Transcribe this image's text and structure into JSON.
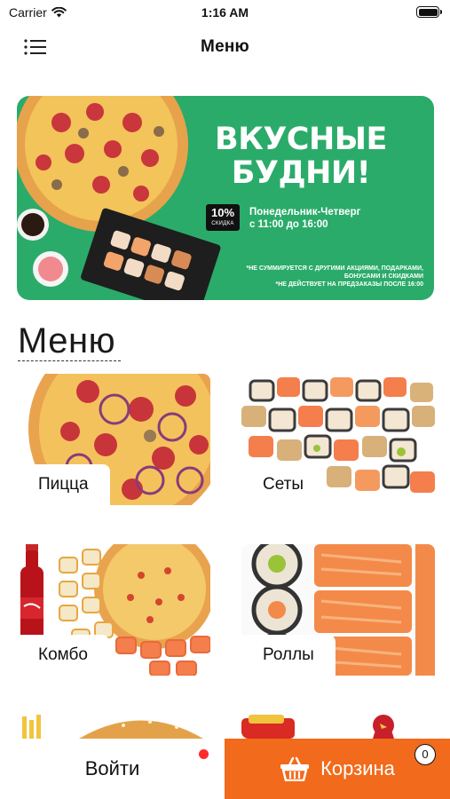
{
  "status_bar": {
    "carrier": "Carrier",
    "time": "1:16 AM"
  },
  "nav": {
    "title": "Меню"
  },
  "banner": {
    "heading_line1": "ВКУСНЫЕ",
    "heading_line2": "БУДНИ!",
    "discount_value": "10%",
    "discount_label": "СКИДКА",
    "days": "Понедельник-Четверг",
    "hours": "с 11:00 до 16:00",
    "note_line1": "*НЕ СУММИРУЕТСЯ С ДРУГИМИ АКЦИЯМИ, ПОДАРКАМИ,",
    "note_line2": "БОНУСАМИ И СКИДКАМИ",
    "note_line3": "*НЕ ДЕЙСТВУЕТ НА ПРЕДЗАКАЗЫ ПОСЛЕ 16:00",
    "background_color": "#2bab6a"
  },
  "section": {
    "title": "Меню"
  },
  "categories": [
    {
      "label": "Пицца",
      "image": "pizza"
    },
    {
      "label": "Сеты",
      "image": "sushi-sets"
    },
    {
      "label": "Комбо",
      "image": "combo"
    },
    {
      "label": "Роллы",
      "image": "rolls"
    },
    {
      "label": "",
      "image": "burger"
    },
    {
      "label": "",
      "image": "kids-toys"
    }
  ],
  "bottom_bar": {
    "login_label": "Войти",
    "cart_label": "Корзина",
    "cart_count": "0",
    "cart_color": "#f26a1b",
    "notification_dot_color": "#ff2a2a"
  }
}
